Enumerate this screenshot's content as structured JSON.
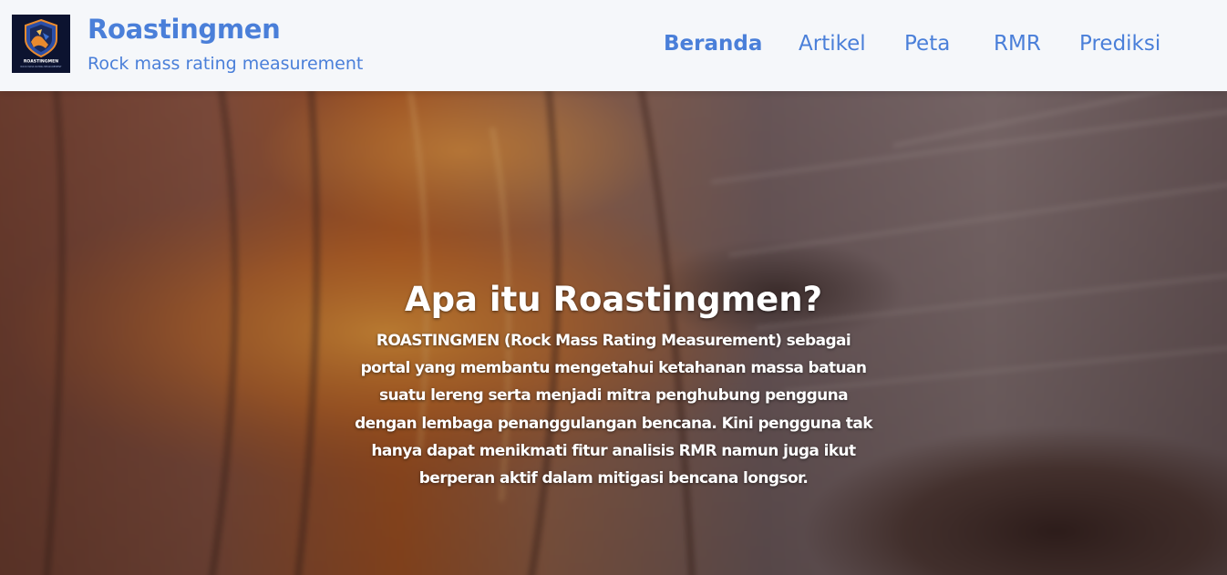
{
  "brand": {
    "title": "Roastingmen",
    "subtitle": "Rock mass rating measurement",
    "logo_text": "ROASTINGMEN",
    "logo_subtext": "ROCK MASS RATING MEASUREMENT"
  },
  "nav": {
    "items": [
      {
        "label": "Beranda",
        "active": true
      },
      {
        "label": "Artikel",
        "active": false
      },
      {
        "label": "Peta",
        "active": false
      },
      {
        "label": "RMR",
        "active": false
      },
      {
        "label": "Prediksi",
        "active": false
      }
    ]
  },
  "hero": {
    "title": "Apa itu Roastingmen?",
    "description": "ROASTINGMEN (Rock Mass Rating Measurement) sebagai portal yang membantu mengetahui ketahanan massa batuan suatu lereng serta menjadi mitra penghubung pengguna dengan lembaga penanggulangan bencana. Kini pengguna tak hanya dapat menikmati fitur analisis RMR namun juga ikut berperan aktif dalam mitigasi bencana longsor."
  },
  "colors": {
    "accent": "#4a7fd9",
    "navbar_bg": "#f5f7fa",
    "logo_bg": "#0c1330"
  }
}
